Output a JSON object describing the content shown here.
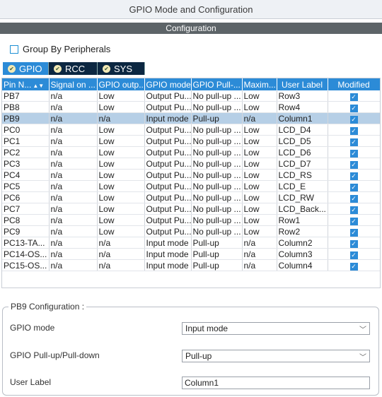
{
  "window": {
    "title": "GPIO Mode and Configuration"
  },
  "config_bar": {
    "label": "Configuration"
  },
  "group_by": {
    "label": "Group By Peripherals",
    "checked": false
  },
  "tabs": [
    {
      "label": "GPIO",
      "active": true
    },
    {
      "label": "RCC",
      "active": false
    },
    {
      "label": "SYS",
      "active": false
    }
  ],
  "table": {
    "headers": [
      "Pin N...",
      "Signal on ...",
      "GPIO outp...",
      "GPIO mode",
      "GPIO Pull-...",
      "Maxim...",
      "User Label",
      "Modified"
    ],
    "rows": [
      {
        "pin": "PB7",
        "signal": "n/a",
        "output": "Low",
        "mode": "Output Pu...",
        "pull": "No pull-up ...",
        "max": "Low",
        "label": "Row3",
        "modified": true,
        "selected": false
      },
      {
        "pin": "PB8",
        "signal": "n/a",
        "output": "Low",
        "mode": "Output Pu...",
        "pull": "No pull-up ...",
        "max": "Low",
        "label": "Row4",
        "modified": true,
        "selected": false
      },
      {
        "pin": "PB9",
        "signal": "n/a",
        "output": "n/a",
        "mode": "Input mode",
        "pull": "Pull-up",
        "max": "n/a",
        "label": "Column1",
        "modified": true,
        "selected": true
      },
      {
        "pin": "PC0",
        "signal": "n/a",
        "output": "Low",
        "mode": "Output Pu...",
        "pull": "No pull-up ...",
        "max": "Low",
        "label": "LCD_D4",
        "modified": true,
        "selected": false
      },
      {
        "pin": "PC1",
        "signal": "n/a",
        "output": "Low",
        "mode": "Output Pu...",
        "pull": "No pull-up ...",
        "max": "Low",
        "label": "LCD_D5",
        "modified": true,
        "selected": false
      },
      {
        "pin": "PC2",
        "signal": "n/a",
        "output": "Low",
        "mode": "Output Pu...",
        "pull": "No pull-up ...",
        "max": "Low",
        "label": "LCD_D6",
        "modified": true,
        "selected": false
      },
      {
        "pin": "PC3",
        "signal": "n/a",
        "output": "Low",
        "mode": "Output Pu...",
        "pull": "No pull-up ...",
        "max": "Low",
        "label": "LCD_D7",
        "modified": true,
        "selected": false
      },
      {
        "pin": "PC4",
        "signal": "n/a",
        "output": "Low",
        "mode": "Output Pu...",
        "pull": "No pull-up ...",
        "max": "Low",
        "label": "LCD_RS",
        "modified": true,
        "selected": false
      },
      {
        "pin": "PC5",
        "signal": "n/a",
        "output": "Low",
        "mode": "Output Pu...",
        "pull": "No pull-up ...",
        "max": "Low",
        "label": "LCD_E",
        "modified": true,
        "selected": false
      },
      {
        "pin": "PC6",
        "signal": "n/a",
        "output": "Low",
        "mode": "Output Pu...",
        "pull": "No pull-up ...",
        "max": "Low",
        "label": "LCD_RW",
        "modified": true,
        "selected": false
      },
      {
        "pin": "PC7",
        "signal": "n/a",
        "output": "Low",
        "mode": "Output Pu...",
        "pull": "No pull-up ...",
        "max": "Low",
        "label": "LCD_Back...",
        "modified": true,
        "selected": false
      },
      {
        "pin": "PC8",
        "signal": "n/a",
        "output": "Low",
        "mode": "Output Pu...",
        "pull": "No pull-up ...",
        "max": "Low",
        "label": "Row1",
        "modified": true,
        "selected": false
      },
      {
        "pin": "PC9",
        "signal": "n/a",
        "output": "Low",
        "mode": "Output Pu...",
        "pull": "No pull-up ...",
        "max": "Low",
        "label": "Row2",
        "modified": true,
        "selected": false
      },
      {
        "pin": "PC13-TA...",
        "signal": "n/a",
        "output": "n/a",
        "mode": "Input mode",
        "pull": "Pull-up",
        "max": "n/a",
        "label": "Column2",
        "modified": true,
        "selected": false
      },
      {
        "pin": "PC14-OS...",
        "signal": "n/a",
        "output": "n/a",
        "mode": "Input mode",
        "pull": "Pull-up",
        "max": "n/a",
        "label": "Column3",
        "modified": true,
        "selected": false
      },
      {
        "pin": "PC15-OS...",
        "signal": "n/a",
        "output": "n/a",
        "mode": "Input mode",
        "pull": "Pull-up",
        "max": "n/a",
        "label": "Column4",
        "modified": true,
        "selected": false
      }
    ]
  },
  "pin_config": {
    "title": "PB9 Configuration :",
    "gpio_mode_label": "GPIO mode",
    "gpio_mode_value": "Input mode",
    "pull_label": "GPIO Pull-up/Pull-down",
    "pull_value": "Pull-up",
    "user_label_label": "User Label",
    "user_label_value": "Column1"
  },
  "colors": {
    "accent": "#2c8bd7",
    "tab_dark": "#0c2741",
    "selected_row": "#b6cfe6",
    "config_bar": "#5d6468"
  }
}
